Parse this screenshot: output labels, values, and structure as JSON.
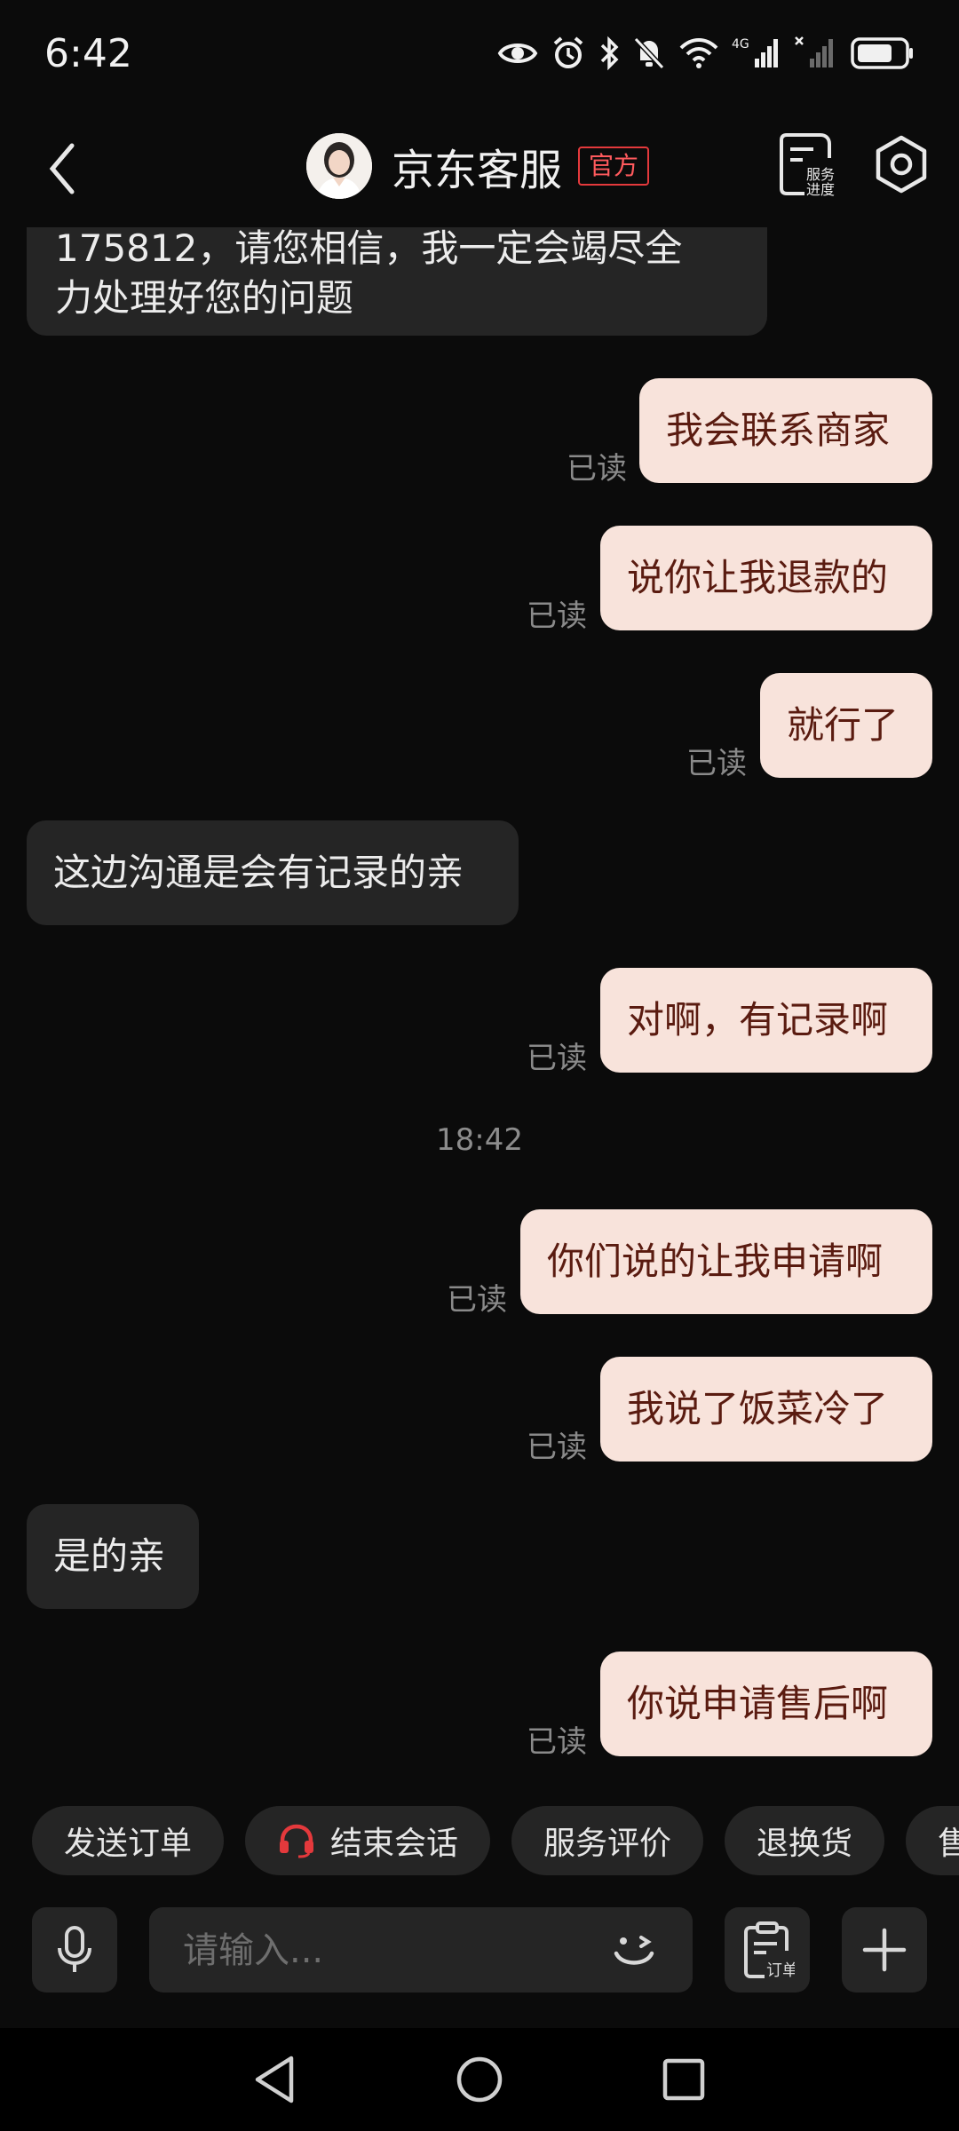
{
  "status_bar": {
    "time": "6:42",
    "network": "4G"
  },
  "header": {
    "title": "京东客服",
    "badge": "官方",
    "service_progress_label_line1": "服务",
    "service_progress_label_line2": "进度"
  },
  "messages": [
    {
      "direction": "incoming",
      "lines": [
        "175812，请您相信，我一定会竭尽全",
        "力处理好您的问题"
      ]
    },
    {
      "direction": "outgoing",
      "text": "我会联系商家",
      "read": "已读"
    },
    {
      "direction": "outgoing",
      "text": "说你让我退款的",
      "read": "已读"
    },
    {
      "direction": "outgoing",
      "text": "就行了",
      "read": "已读"
    },
    {
      "direction": "incoming",
      "text": "这边沟通是会有记录的亲"
    },
    {
      "direction": "outgoing",
      "text": "对啊，有记录啊",
      "read": "已读"
    },
    {
      "direction": "outgoing",
      "text": "你们说的让我申请啊",
      "read": "已读"
    },
    {
      "direction": "outgoing",
      "text": "我说了饭菜冷了",
      "read": "已读"
    },
    {
      "direction": "incoming",
      "text": "是的亲"
    },
    {
      "direction": "outgoing",
      "text": "你说申请售后啊",
      "read": "已读"
    }
  ],
  "time_divider": "18:42",
  "quick_actions": [
    "发送订单",
    "结束会话",
    "服务评价",
    "退换货",
    "售"
  ],
  "input": {
    "placeholder": "请输入..."
  },
  "order_button_label": "订单",
  "colors": {
    "background": "#0b0b0b",
    "incoming_bubble": "#252525",
    "outgoing_bubble": "#f8e3db",
    "outgoing_text": "#5a1b10",
    "official_badge": "#e4393c",
    "headset_icon": "#e4393c"
  }
}
